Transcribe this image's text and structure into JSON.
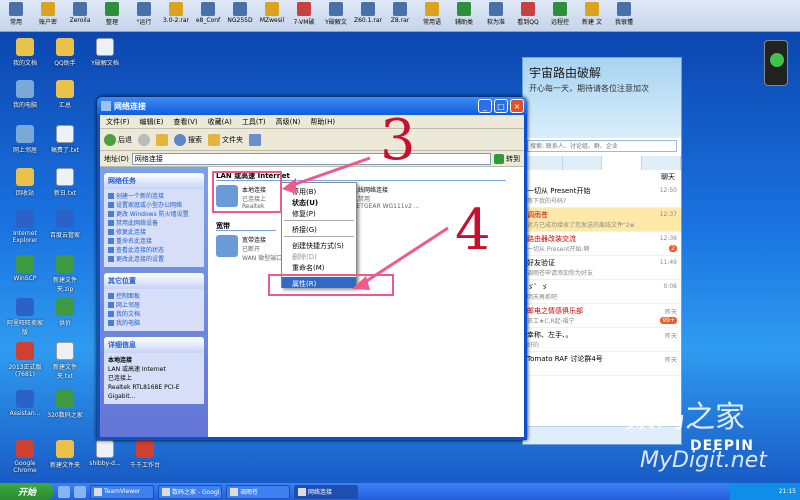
{
  "topbar": [
    "常用",
    "账户密",
    "Zeroila",
    "整理",
    "\"运行",
    "3.0-2.rar",
    "e8_Conf",
    "NG255D",
    "MZwesil",
    "7-VM破",
    "Y破解文",
    "Z60.1.rar",
    "Z8.rar",
    "常用语",
    "辅助类",
    "软为准",
    "看到QQ",
    "远程控",
    "新建 文",
    "我很懂"
  ],
  "desktop_icons": [
    {
      "label": "我的文档"
    },
    {
      "label": "QQ助手"
    },
    {
      "label": "Y破解文档"
    },
    {
      "label": "我的电脑"
    },
    {
      "label": "汇总"
    },
    {
      "label": "网上邻居"
    },
    {
      "label": "稿费了.txt"
    },
    {
      "label": "回收站"
    },
    {
      "label": "新日.txt"
    },
    {
      "label": "Internet Explorer"
    },
    {
      "label": "百度云管家"
    },
    {
      "label": "WinSCP"
    },
    {
      "label": "新建文件夹.zip"
    },
    {
      "label": "阿里旺旺卖家版"
    },
    {
      "label": "供价"
    },
    {
      "label": "2013正式版(7681)"
    },
    {
      "label": "新建文件夹.txt"
    },
    {
      "label": "Assistan..."
    },
    {
      "label": "320数码之家"
    },
    {
      "label": "Google Chrome"
    },
    {
      "label": "新建文件夹"
    },
    {
      "label": "shibby-d..."
    },
    {
      "label": "千千工作台"
    }
  ],
  "window": {
    "title": "网络连接",
    "menu": [
      "文件(F)",
      "编辑(E)",
      "查看(V)",
      "收藏(A)",
      "工具(T)",
      "高级(N)",
      "帮助(H)"
    ],
    "toolbar": {
      "back": "后退",
      "search": "搜索",
      "folders": "文件夹"
    },
    "address": {
      "label": "地址(D)",
      "value": "网络连接",
      "go": "转到"
    },
    "tasks": {
      "title": "网络任务",
      "items": [
        "创建一个新的连接",
        "设置家庭或小型办公网络",
        "更改 Windows 防火墙设置",
        "禁用此网络设备",
        "修复此连接",
        "重命名此连接",
        "查看此连接的状态",
        "更改此连接的设置"
      ]
    },
    "other": {
      "title": "其它位置",
      "items": [
        "控制面板",
        "网上邻居",
        "我的文档",
        "我的电脑"
      ]
    },
    "details": {
      "title": "详细信息",
      "name": "本地连接",
      "type": "LAN 或高速 Internet",
      "status": "已连接上",
      "extra": "Realtek RTL8168E PCI-E Gigabit..."
    },
    "groups": {
      "lan": "LAN 或高速 Internet",
      "broadband": "宽带"
    },
    "connections": {
      "local": {
        "name": "本地连接",
        "sub1": "已连接上",
        "sub2": "Realtek"
      },
      "wireless": {
        "name": "无线网络连接",
        "sub1": "已禁用",
        "sub2": "NETGEAR WG111v2 ..."
      },
      "broadband": {
        "name": "宽带连接",
        "sub1": "已断开",
        "sub2": "WAN 微型端口"
      }
    },
    "context_menu": [
      "停用(B)",
      "状态(U)",
      "修复(P)",
      "桥接(G)",
      "创建快捷方式(S)",
      "删除(D)",
      "重命名(M)",
      "属性(R)"
    ]
  },
  "annotations": {
    "step3": "3",
    "step4": "4"
  },
  "qq": {
    "title": "宇宙路由破解",
    "subtitle": "开心每一天，期待请各位注意加次",
    "search_placeholder": "搜索: 联系人、讨论组、群、企业",
    "chat_label": "聊天",
    "rows": [
      {
        "name": "一切从 Present开始",
        "msg": "等下我的号码?",
        "time": "12:50",
        "badge": ""
      },
      {
        "name": "调雨苍",
        "msg": "对方已成功接收了您发送的离线文件\"2w",
        "time": "12:37",
        "badge": ""
      },
      {
        "name": "路由器改装交流",
        "msg": "一切从 Present开始:啊",
        "time": "12:36",
        "badge": "2"
      },
      {
        "name": "好友验证",
        "msg": "调雨苍申请添加你为好友",
        "time": "11:49",
        "badge": ""
      },
      {
        "name": "ゞ゜ゞ",
        "msg": "明天再抓吧",
        "time": "0:08",
        "badge": ""
      },
      {
        "name": "邮电之情感俱乐部",
        "msg": "员工★C,R起·福宁",
        "time": "昨天",
        "badge": "99+"
      },
      {
        "name": "幸称、左手、。",
        "msg": "好的",
        "time": "昨天",
        "badge": ""
      },
      {
        "name": "Tomato RAF 讨论群4号",
        "msg": "",
        "time": "昨天",
        "badge": ""
      }
    ]
  },
  "watermark": {
    "brand": "DEEPIN",
    "site": "数码之家",
    "url": "MyDigit.net"
  },
  "taskbar": {
    "start": "开始",
    "tasks": [
      "TeamViewer",
      "数码之家 - Googl...",
      "调雨苍",
      "网络连接"
    ],
    "time": "21:15"
  }
}
